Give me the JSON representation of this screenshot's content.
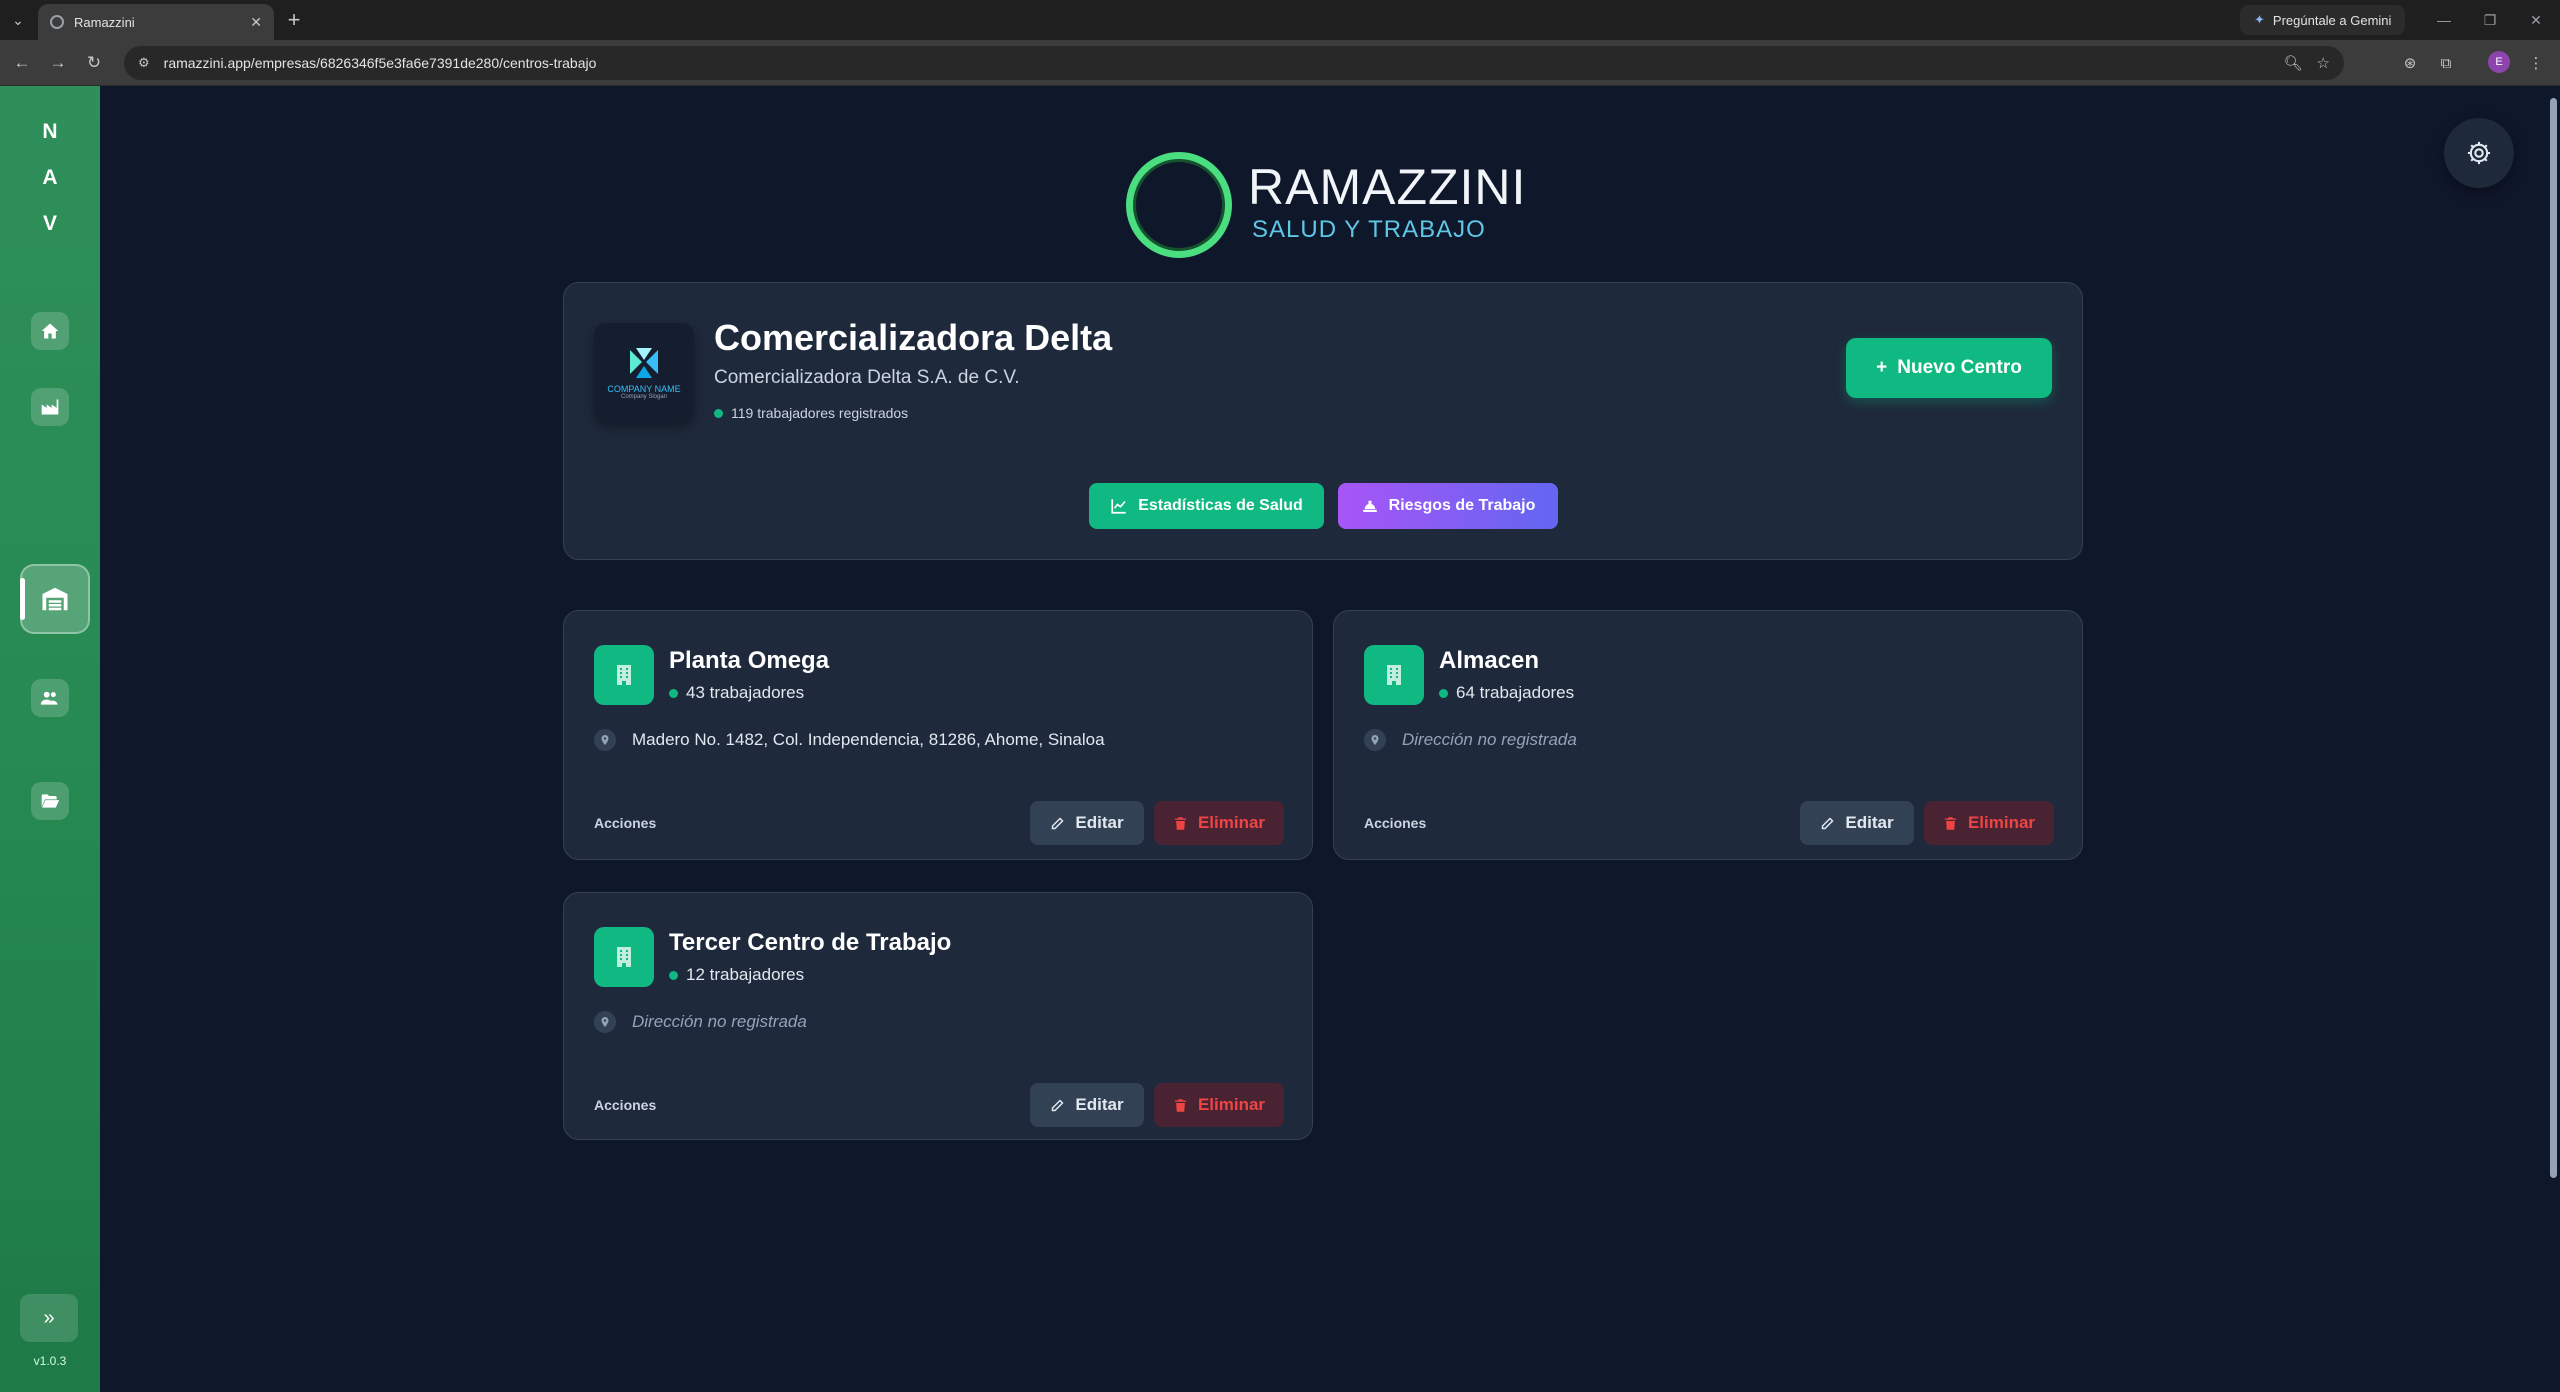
{
  "browser": {
    "tab_title": "Ramazzini",
    "url": "ramazzini.app/empresas/6826346f5e3fa6e7391de280/centros-trabajo",
    "gemini_label": "Pregúntale a Gemini",
    "profile_initial": "E"
  },
  "sidebar": {
    "letters": [
      "N",
      "A",
      "V"
    ],
    "items": [
      {
        "name": "home",
        "icon": "home-icon"
      },
      {
        "name": "empresas",
        "icon": "industry-icon"
      },
      {
        "name": "centros-trabajo",
        "icon": "warehouse-icon",
        "active": true
      },
      {
        "name": "trabajadores",
        "icon": "users-icon"
      },
      {
        "name": "expedientes",
        "icon": "folder-open-icon"
      }
    ],
    "expand_icon": "chevron-double-right-icon",
    "version": "v1.0.3"
  },
  "logo": {
    "title": "RAMAZZINI",
    "subtitle": "SALUD Y TRABAJO"
  },
  "company": {
    "logo_name": "COMPANY NAME",
    "logo_slogan": "Company Slogan",
    "name": "Comercializadora Delta",
    "legal_name": "Comercializadora Delta S.A. de C.V.",
    "workers": "119 trabajadores registrados",
    "new_center_label": "Nuevo Centro",
    "stats_label": "Estadísticas de Salud",
    "risks_label": "Riesgos de Trabajo"
  },
  "centers": [
    {
      "name": "Planta Omega",
      "workers": "43 trabajadores",
      "address": "Madero No. 1482, Col. Independencia, 81286, Ahome, Sinaloa",
      "actions_label": "Acciones",
      "edit_label": "Editar",
      "delete_label": "Eliminar"
    },
    {
      "name": "Almacen",
      "workers": "64 trabajadores",
      "address": "Dirección no registrada",
      "actions_label": "Acciones",
      "edit_label": "Editar",
      "delete_label": "Eliminar"
    },
    {
      "name": "Tercer Centro de Trabajo",
      "workers": "12 trabajadores",
      "address": "Dirección no registrada",
      "actions_label": "Acciones",
      "edit_label": "Editar",
      "delete_label": "Eliminar"
    }
  ],
  "colors": {
    "background": "#0f172a",
    "card": "#1e293b",
    "accent_green": "#10b981",
    "sidebar_green": "#2f8f5a",
    "danger": "#ef4444",
    "purple": "#a855f7"
  }
}
